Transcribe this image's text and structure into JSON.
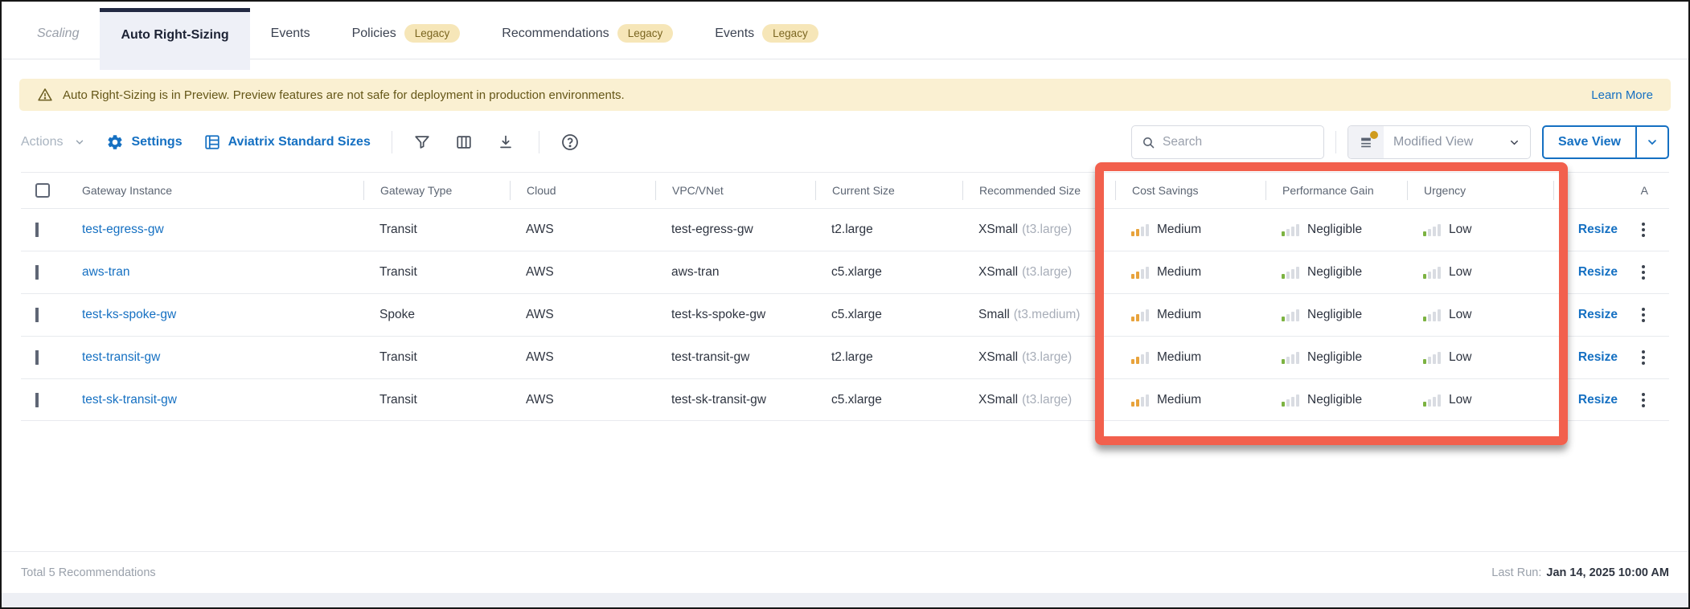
{
  "tabs": [
    {
      "label": "Scaling",
      "state": "disabled"
    },
    {
      "label": "Auto Right-Sizing",
      "state": "active"
    },
    {
      "label": "Events",
      "state": "normal"
    },
    {
      "label": "Policies",
      "state": "normal",
      "badge": "Legacy"
    },
    {
      "label": "Recommendations",
      "state": "normal",
      "badge": "Legacy"
    },
    {
      "label": "Events",
      "state": "normal",
      "badge": "Legacy"
    }
  ],
  "banner": {
    "text": "Auto Right-Sizing is in Preview. Preview features are not safe for deployment in production environments.",
    "link_label": "Learn More"
  },
  "toolbar": {
    "actions_label": "Actions",
    "settings_label": "Settings",
    "standard_sizes_label": "Aviatrix Standard Sizes",
    "search_placeholder": "Search",
    "view_selector_label": "Modified View",
    "save_view_label": "Save View"
  },
  "table": {
    "columns": [
      "Gateway Instance",
      "Gateway Type",
      "Cloud",
      "VPC/VNet",
      "Current Size",
      "Recommended Size",
      "Cost Savings",
      "Performance Gain",
      "Urgency",
      "A"
    ],
    "rows": [
      {
        "name": "test-egress-gw",
        "type": "Transit",
        "cloud": "AWS",
        "vpc": "test-egress-gw",
        "current_size": "t2.large",
        "rec_size": "XSmall",
        "rec_instance": "(t3.large)",
        "cost_savings": "Medium",
        "cost_level": 2,
        "performance_gain": "Negligible",
        "performance_level": 1,
        "urgency": "Low",
        "urgency_level": 1,
        "action": "Resize"
      },
      {
        "name": "aws-tran",
        "type": "Transit",
        "cloud": "AWS",
        "vpc": "aws-tran",
        "current_size": "c5.xlarge",
        "rec_size": "XSmall",
        "rec_instance": "(t3.large)",
        "cost_savings": "Medium",
        "cost_level": 2,
        "performance_gain": "Negligible",
        "performance_level": 1,
        "urgency": "Low",
        "urgency_level": 1,
        "action": "Resize"
      },
      {
        "name": "test-ks-spoke-gw",
        "type": "Spoke",
        "cloud": "AWS",
        "vpc": "test-ks-spoke-gw",
        "current_size": "c5.xlarge",
        "rec_size": "Small",
        "rec_instance": "(t3.medium)",
        "cost_savings": "Medium",
        "cost_level": 2,
        "performance_gain": "Negligible",
        "performance_level": 1,
        "urgency": "Low",
        "urgency_level": 1,
        "action": "Resize"
      },
      {
        "name": "test-transit-gw",
        "type": "Transit",
        "cloud": "AWS",
        "vpc": "test-transit-gw",
        "current_size": "t2.large",
        "rec_size": "XSmall",
        "rec_instance": "(t3.large)",
        "cost_savings": "Medium",
        "cost_level": 2,
        "performance_gain": "Negligible",
        "performance_level": 1,
        "urgency": "Low",
        "urgency_level": 1,
        "action": "Resize"
      },
      {
        "name": "test-sk-transit-gw",
        "type": "Transit",
        "cloud": "AWS",
        "vpc": "test-sk-transit-gw",
        "current_size": "c5.xlarge",
        "rec_size": "XSmall",
        "rec_instance": "(t3.large)",
        "cost_savings": "Medium",
        "cost_level": 2,
        "performance_gain": "Negligible",
        "performance_level": 1,
        "urgency": "Low",
        "urgency_level": 1,
        "action": "Resize"
      }
    ]
  },
  "footer": {
    "total": "Total 5 Recommendations",
    "last_run_label": "Last Run:",
    "last_run_value": "Jan 14, 2025 10:00 AM"
  },
  "colors": {
    "accent_blue": "#1570c2",
    "highlight_red": "#f2604d",
    "banner_bg": "#faf0d2",
    "banner_text": "#655718",
    "legacy_badge_bg": "#f6e6b8",
    "legacy_badge_text": "#7a6520",
    "active_tab_bar": "#222943",
    "cost_bar_fill": "#e8a33c",
    "gain_bar_fill": "#7cb342",
    "bar_empty": "#d9dce2"
  }
}
